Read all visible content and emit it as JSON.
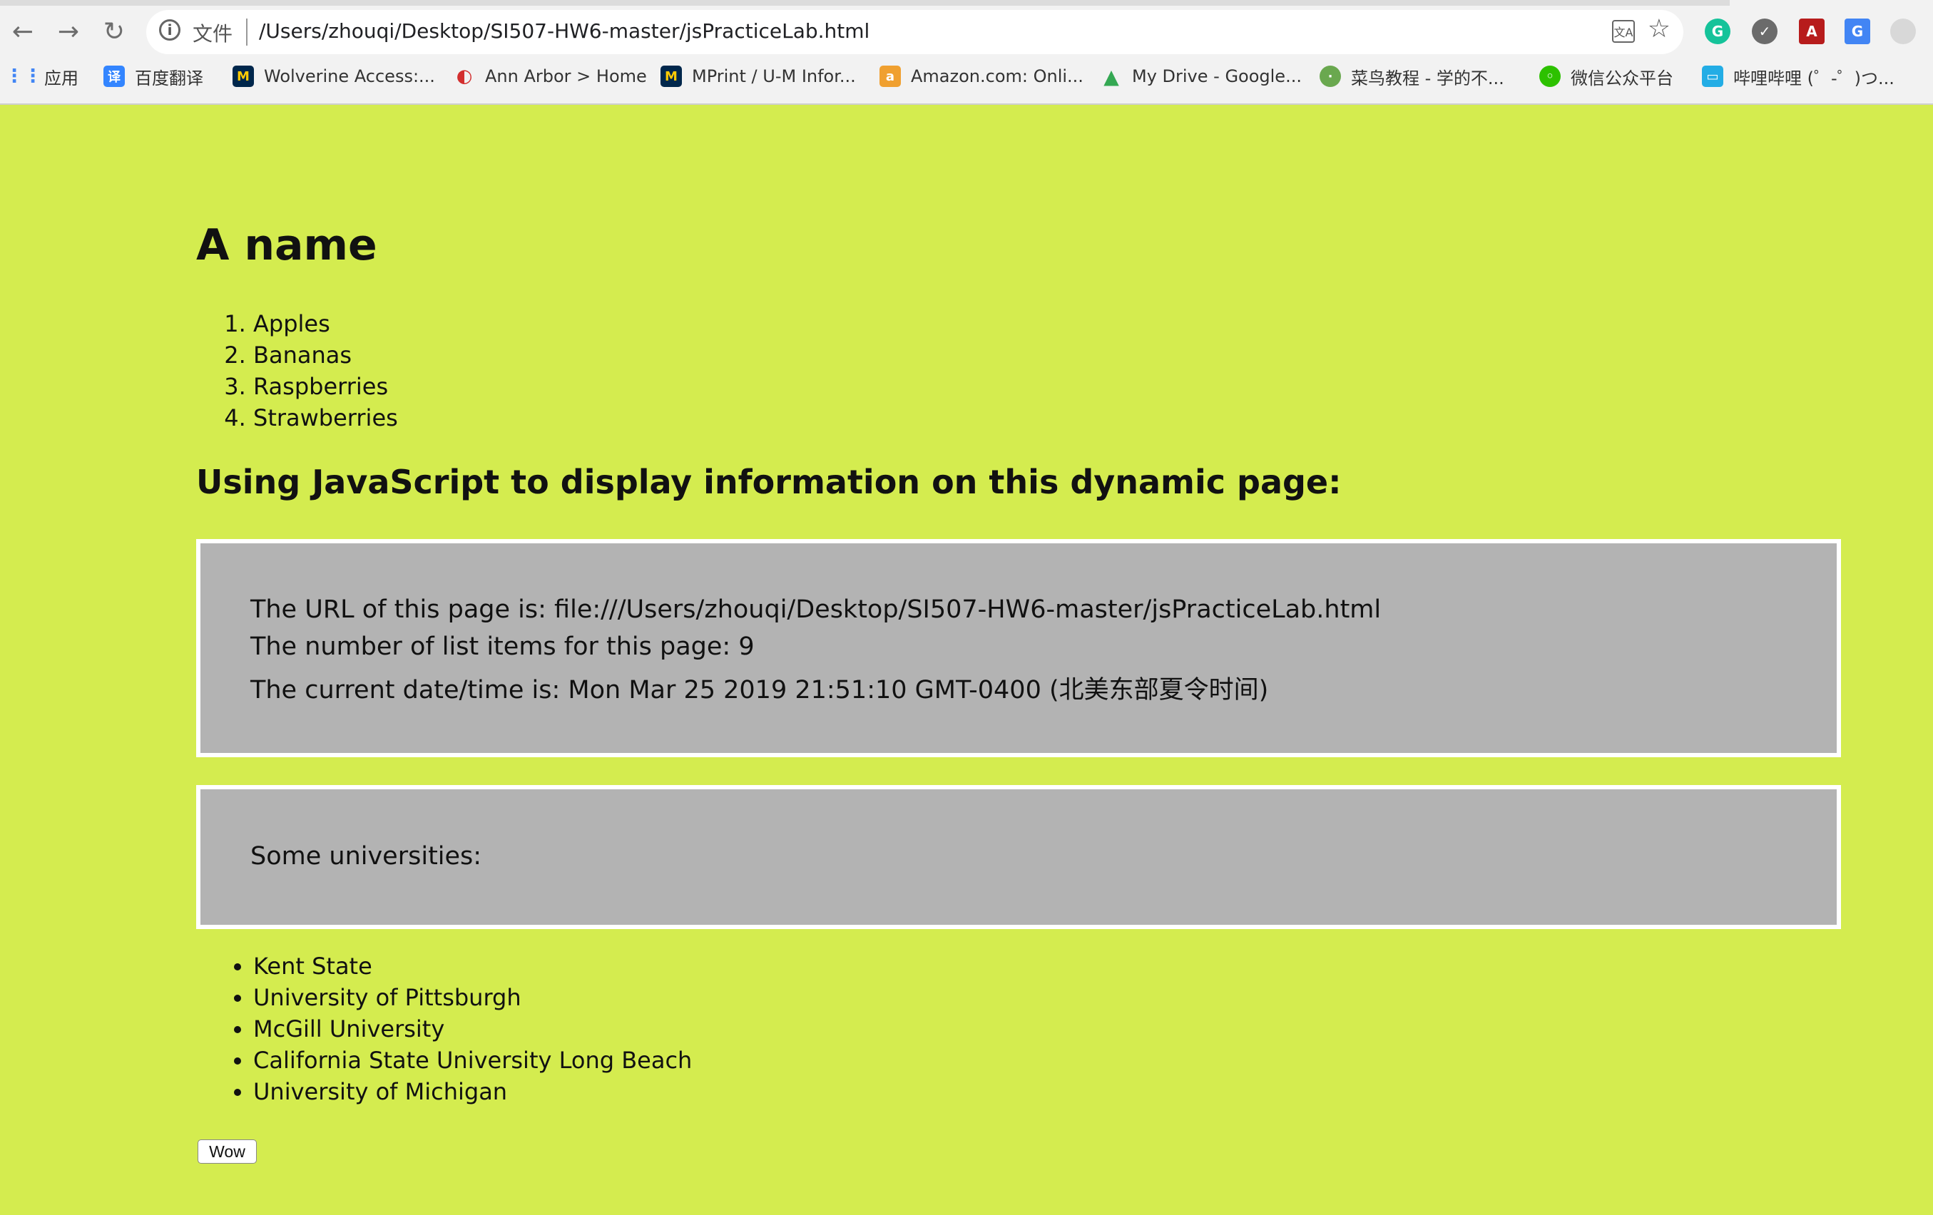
{
  "browser": {
    "scheme_label": "文件",
    "url": "/Users/zhouqi/Desktop/SI507-HW6-master/jsPracticeLab.html",
    "translate_icon": "translate-icon",
    "bookmark_icon": "star-icon"
  },
  "bookmarks": [
    {
      "label": "应用",
      "icon": "apps-grid-icon",
      "color": "#4285f4"
    },
    {
      "label": "百度翻译",
      "icon": "baidu-translate-icon",
      "color": "#3385ff"
    },
    {
      "label": "Wolverine Access:...",
      "icon": "umich-icon",
      "color": "#00274c"
    },
    {
      "label": "Ann Arbor > Home",
      "icon": "ann-arbor-icon",
      "color": "#d32f2f"
    },
    {
      "label": "MPrint / U-M Infor...",
      "icon": "umich-icon",
      "color": "#00274c"
    },
    {
      "label": "Amazon.com: Onli...",
      "icon": "amazon-icon",
      "color": "#f0a030"
    },
    {
      "label": "My Drive - Google...",
      "icon": "google-drive-icon",
      "color": "#34a853"
    },
    {
      "label": "菜鸟教程 - 学的不...",
      "icon": "runoob-icon",
      "color": "#6aa84f"
    },
    {
      "label": "微信公众平台",
      "icon": "wechat-icon",
      "color": "#2dc100"
    },
    {
      "label": "哔哩哔哩 (゜-゜)つ...",
      "icon": "bilibili-icon",
      "color": "#23ade5"
    }
  ],
  "page": {
    "heading": "A name",
    "fruits": [
      "Apples",
      "Bananas",
      "Raspberries",
      "Strawberries"
    ],
    "subheading": "Using JavaScript to display information on this dynamic page:",
    "info": {
      "url_line": "The URL of this page is: file:///Users/zhouqi/Desktop/SI507-HW6-master/jsPracticeLab.html",
      "count_line": "The number of list items for this page: 9",
      "date_line": "The current date/time is: Mon Mar 25 2019 21:51:10 GMT-0400 (北美东部夏令时间)"
    },
    "universities_label": "Some universities:",
    "universities": [
      "Kent State",
      "University of Pittsburgh",
      "McGill University",
      "California State University Long Beach",
      "University of Michigan"
    ],
    "button_label": "Wow"
  },
  "colors": {
    "page_background": "#d4ec4f",
    "box_background": "#b3b3b3",
    "box_border": "#ffffff"
  }
}
